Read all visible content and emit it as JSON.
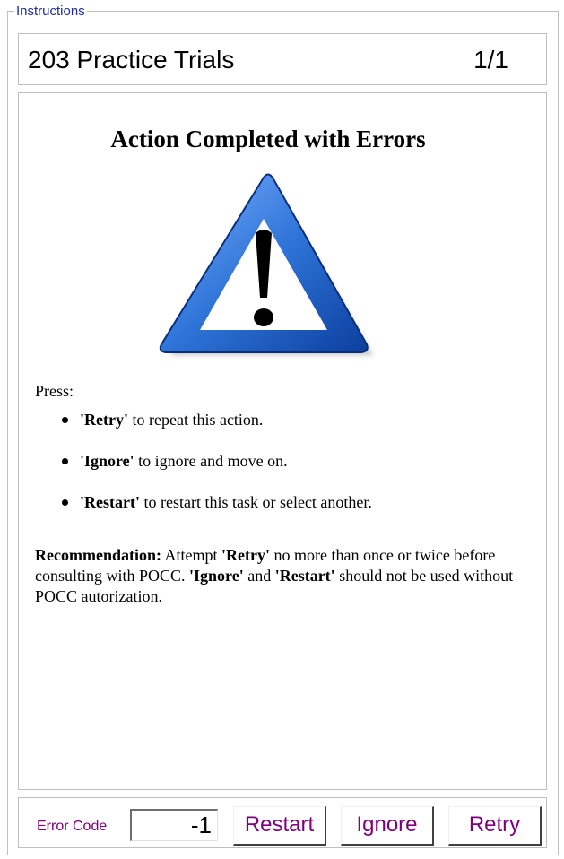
{
  "group": {
    "legend": "Instructions"
  },
  "header": {
    "title": "203 Practice Trials",
    "page_indicator": "1/1"
  },
  "content": {
    "heading": "Action Completed with Errors",
    "icon": "warning-triangle-icon",
    "press_label": "Press:",
    "options": [
      {
        "name": "'Retry'",
        "text": " to repeat this action."
      },
      {
        "name": "'Ignore'",
        "text": " to ignore and move on."
      },
      {
        "name": "'Restart'",
        "text": " to restart this task or select another."
      }
    ],
    "recommendation": {
      "label": "Recommendation:",
      "part1": " Attempt ",
      "retry": "'Retry'",
      "part2": " no more than once or twice before consulting with POCC. ",
      "ignore": "'Ignore'",
      "and": " and ",
      "restart": "'Restart'",
      "part3": " should not be used without POCC autorization."
    }
  },
  "footer": {
    "error_code_label": "Error Code",
    "error_code_value": "-1",
    "restart_label": "Restart",
    "ignore_label": "Ignore",
    "retry_label": "Retry"
  },
  "colors": {
    "legend": "#1f2f9f",
    "button_text": "#800080",
    "warning_blue": "#1e63c8"
  }
}
